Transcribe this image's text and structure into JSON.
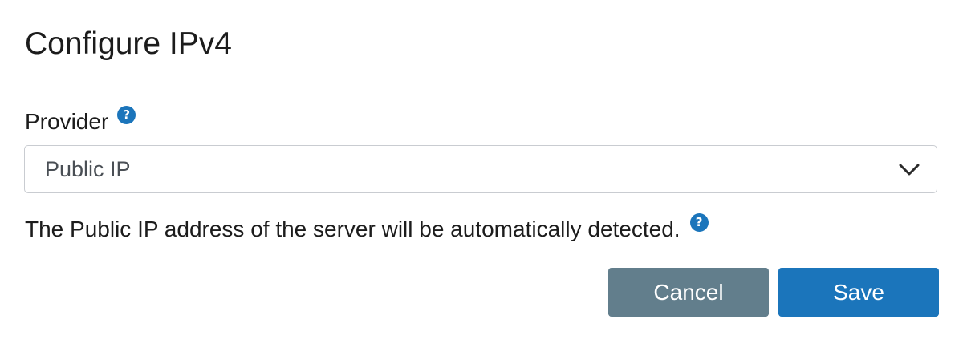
{
  "dialog": {
    "title": "Configure IPv4"
  },
  "provider_field": {
    "label": "Provider",
    "help_icon": "question-mark-icon",
    "selected_value": "Public IP",
    "dropdown_icon": "chevron-down-icon"
  },
  "description": {
    "text": "The Public IP address of the server will be automatically detected.",
    "help_icon": "question-mark-icon"
  },
  "actions": {
    "cancel_label": "Cancel",
    "save_label": "Save"
  },
  "colors": {
    "primary": "#1b75bb",
    "secondary": "#627e8c",
    "border": "#c9ccd1"
  }
}
